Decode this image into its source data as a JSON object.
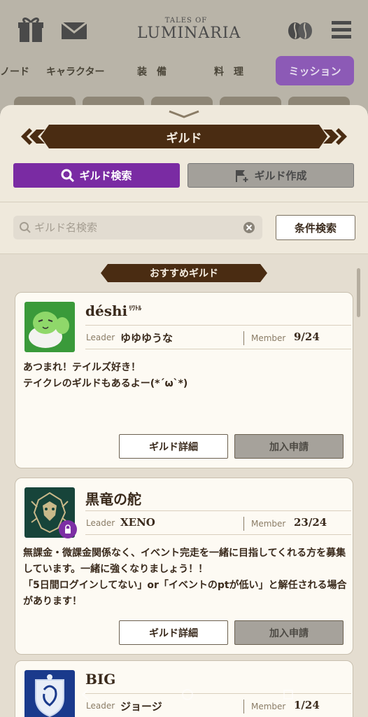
{
  "header": {
    "logo_top": "TALES OF",
    "logo_main": "LUMINARIA",
    "nav": [
      "ノード",
      "キャラクター",
      "装　備",
      "料　理"
    ],
    "mission_label": "ミッション"
  },
  "panel": {
    "title": "ギルド",
    "tabs": {
      "search_label": "ギルド検索",
      "create_label": "ギルド作成"
    },
    "search": {
      "placeholder": "ギルド名検索",
      "value": ""
    },
    "condition_button": "条件検索",
    "section_label": "おすすめギルド"
  },
  "guilds": [
    {
      "name": "déshi",
      "name_ruby": "ﾘﾜﾄﾙ",
      "leader_label": "Leader",
      "leader": "ゆゆゆうな",
      "member_label": "Member",
      "members": "9/24",
      "description": "あつまれ！テイルズ好き！\nテイクレのギルドもあるよー(*´ω`*)",
      "detail_button": "ギルド詳細",
      "join_button": "加入申請",
      "locked": false
    },
    {
      "name": "黒竜の舵",
      "name_ruby": "",
      "leader_label": "Leader",
      "leader": "XENO",
      "member_label": "Member",
      "members": "23/24",
      "description": "無課金・微課金関係なく、イベント完走を一緒に目指してくれる方を募集しています。一緒に強くなりましょう！！\n「5日間ログインしてない」or「イベントのptが低い」と解任される場合があります！",
      "detail_button": "ギルド詳細",
      "join_button": "加入申請",
      "locked": true
    },
    {
      "name": "BIG",
      "name_ruby": "",
      "leader_label": "Leader",
      "leader": "ジョージ",
      "member_label": "Member",
      "members": "1/24",
      "locked": false
    }
  ],
  "colors": {
    "accent_purple": "#7a2ba3",
    "banner_brown": "#4a2c12",
    "card_bg": "#fdfaf3"
  }
}
